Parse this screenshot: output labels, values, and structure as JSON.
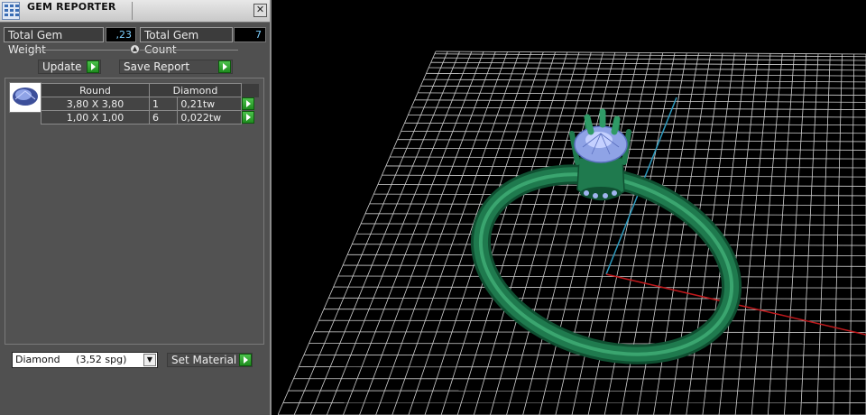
{
  "window": {
    "title": "GEM REPORTER",
    "close_glyph": "✕"
  },
  "totals": {
    "weight_label": "Total Gem Weight",
    "weight_value": ",23",
    "count_label": "Total Gem Count",
    "count_value": "7"
  },
  "buttons": {
    "update": "Update",
    "save_report": "Save Report",
    "set_material": "Set Material"
  },
  "table": {
    "header": {
      "cut": "Round",
      "material": "Diamond"
    },
    "rows": [
      {
        "size": "3,80 X 3,80",
        "count": "1",
        "weight": "0,21tw"
      },
      {
        "size": "1,00 X 1,00",
        "count": "6",
        "weight": "0,022tw"
      }
    ]
  },
  "material_select": {
    "value": "Diamond     (3,52 spg)"
  },
  "colors": {
    "ring": "#1f7a4e",
    "gem": "#9fb4ef",
    "grid": "#d0d0d0",
    "axis_y": "#2d9bbf",
    "axis_x": "#c0191c",
    "play": "#2faa2f"
  },
  "icons": [
    "app-icon",
    "close-icon",
    "slider-knob-icon",
    "play-icon",
    "gem-thumbnail-icon",
    "chevron-down-icon"
  ]
}
